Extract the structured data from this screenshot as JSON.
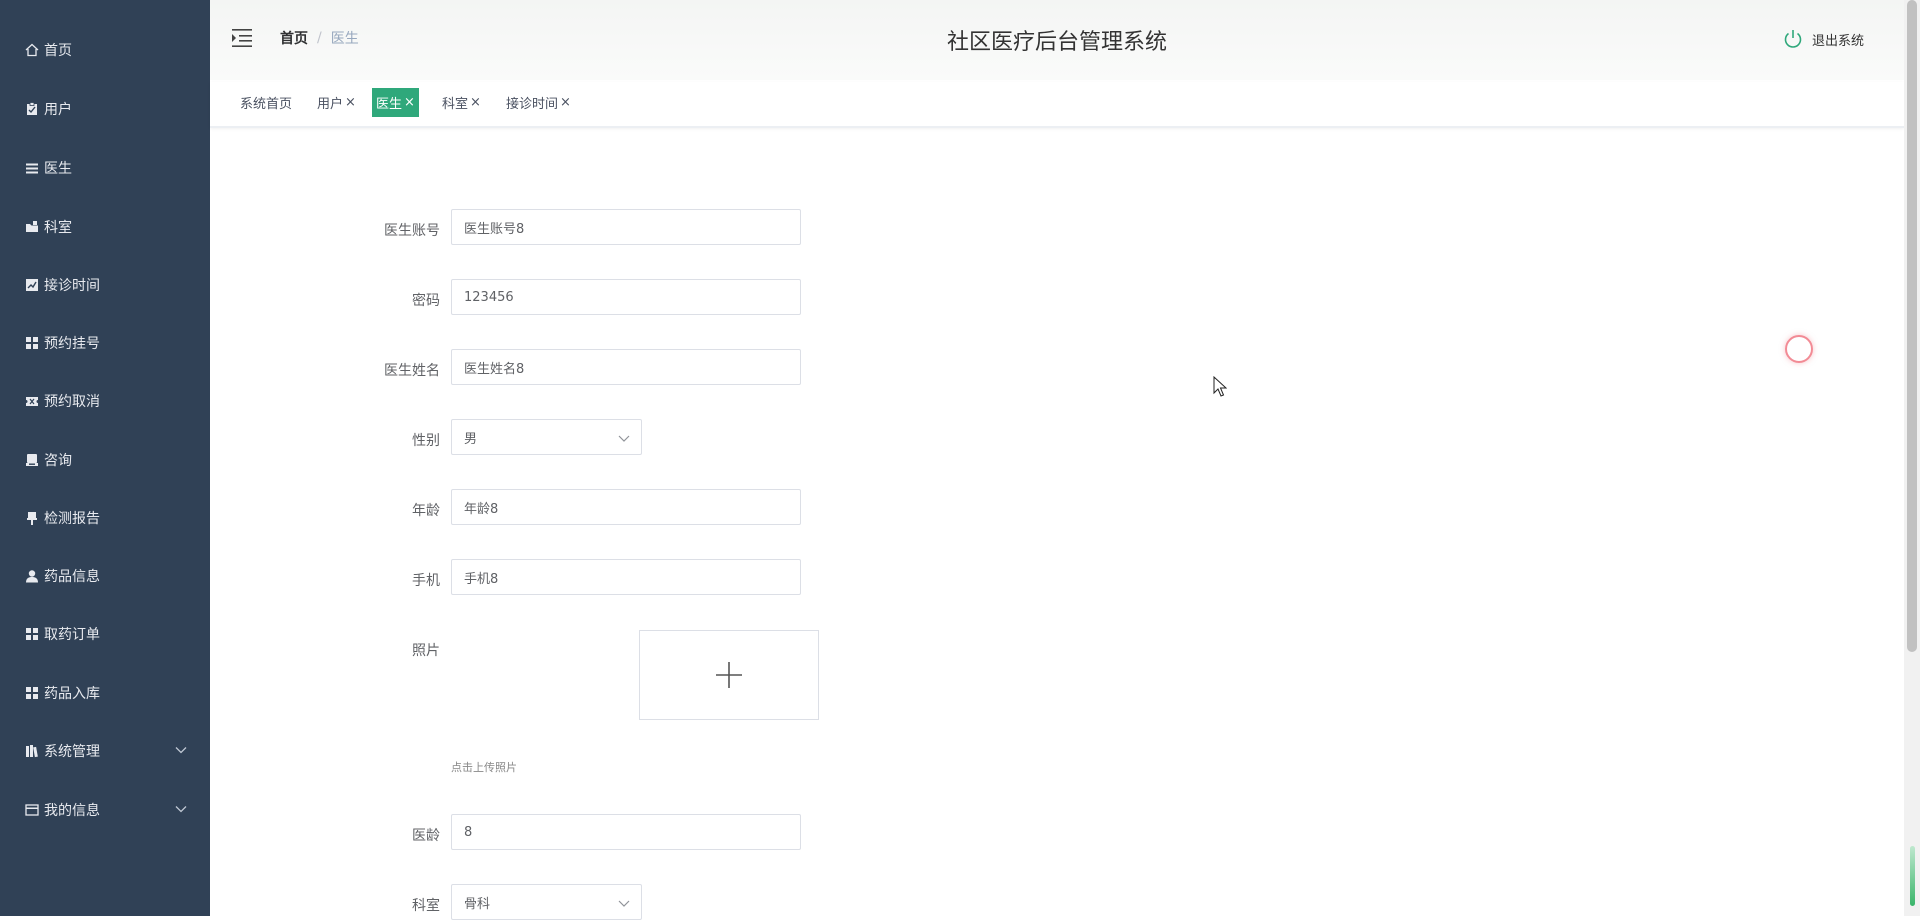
{
  "sidebar": {
    "items": [
      {
        "label": "首页",
        "icon": "home-icon"
      },
      {
        "label": "用户",
        "icon": "clipboard-icon"
      },
      {
        "label": "医生",
        "icon": "list-icon"
      },
      {
        "label": "科室",
        "icon": "folder-icon"
      },
      {
        "label": "接诊时间",
        "icon": "chart-icon"
      },
      {
        "label": "预约挂号",
        "icon": "grid-icon"
      },
      {
        "label": "预约取消",
        "icon": "ticket-icon"
      },
      {
        "label": "咨询",
        "icon": "printer-icon"
      },
      {
        "label": "检测报告",
        "icon": "thumbtack-icon"
      },
      {
        "label": "药品信息",
        "icon": "user-icon"
      },
      {
        "label": "取药订单",
        "icon": "grid-icon"
      },
      {
        "label": "药品入库",
        "icon": "grid-icon"
      },
      {
        "label": "系统管理",
        "icon": "book-icon",
        "expandable": true
      },
      {
        "label": "我的信息",
        "icon": "card-icon",
        "expandable": true
      }
    ]
  },
  "header": {
    "breadcrumb_home": "首页",
    "breadcrumb_separator": "/",
    "breadcrumb_current": "医生",
    "title": "社区医疗后台管理系统",
    "logout_label": "退出系统"
  },
  "tags": {
    "items": [
      {
        "label": "系统首页",
        "closable": false,
        "active": false
      },
      {
        "label": "用户",
        "closable": true,
        "active": false
      },
      {
        "label": "医生",
        "closable": true,
        "active": true
      },
      {
        "label": "科室",
        "closable": true,
        "active": false
      },
      {
        "label": "接诊时间",
        "closable": true,
        "active": false
      }
    ],
    "close_glyph": "×"
  },
  "form": {
    "account_label": "医生账号",
    "account_value": "医生账号8",
    "password_label": "密码",
    "password_value": "123456",
    "name_label": "医生姓名",
    "name_value": "医生姓名8",
    "gender_label": "性别",
    "gender_value": "男",
    "age_label": "年龄",
    "age_value": "年龄8",
    "phone_label": "手机",
    "phone_value": "手机8",
    "photo_label": "照片",
    "upload_hint": "点击上传照片",
    "experience_label": "医龄",
    "experience_value": "8",
    "department_label": "科室",
    "department_value": "骨科"
  },
  "colors": {
    "sidebar_bg": "#304156",
    "active_tag": "#2fa87b",
    "logout_icon": "#2fa87b"
  }
}
